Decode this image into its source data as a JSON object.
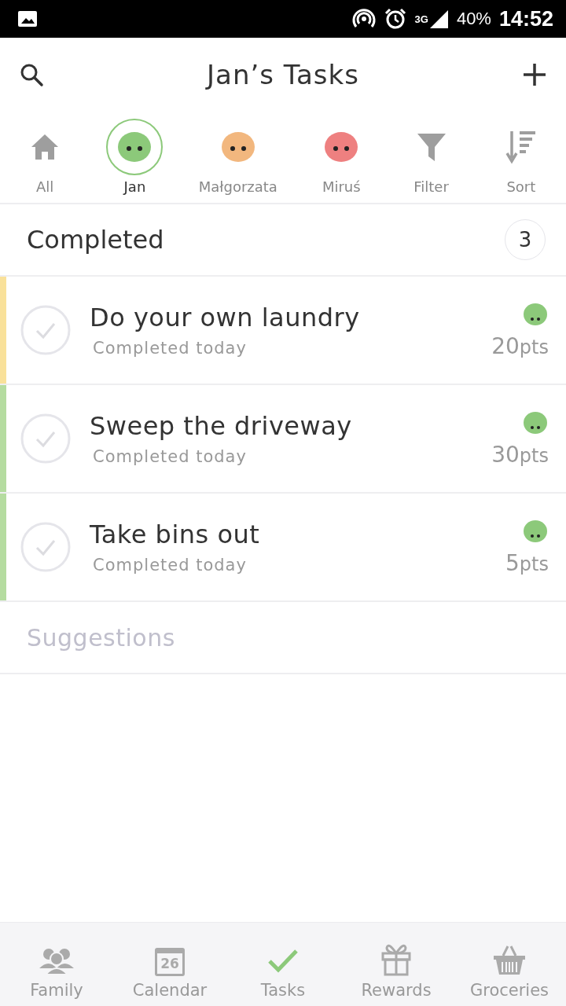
{
  "status_bar": {
    "battery": "40%",
    "network": "3G",
    "time": "14:52"
  },
  "header": {
    "title": "Jan’s Tasks"
  },
  "people": [
    {
      "label": "All",
      "kind": "home",
      "selected": false
    },
    {
      "label": "Jan",
      "kind": "avatar",
      "color": "#8cc97a",
      "selected": true
    },
    {
      "label": "Małgorzata",
      "kind": "avatar",
      "color": "#f2b77e",
      "selected": false
    },
    {
      "label": "Miruś",
      "kind": "avatar",
      "color": "#ee8080",
      "selected": false
    },
    {
      "label": "Filter",
      "kind": "filter",
      "selected": false
    },
    {
      "label": "Sort",
      "kind": "sort",
      "selected": false
    }
  ],
  "completed": {
    "title": "Completed",
    "count": "3"
  },
  "tasks": [
    {
      "title": "Do your own laundry",
      "subtitle": "Completed today",
      "points": "20",
      "unit": "pts",
      "color": "#f9e19a",
      "checked": true
    },
    {
      "title": "Sweep the driveway",
      "subtitle": "Completed today",
      "points": "30",
      "unit": "pts",
      "color": "#b5dca0",
      "checked": true
    },
    {
      "title": "Take bins out",
      "subtitle": "Completed today",
      "points": "5",
      "unit": "pts",
      "color": "#b5dca0",
      "checked": true
    }
  ],
  "suggestions": {
    "title": "Suggestions"
  },
  "bottom_nav": [
    {
      "label": "Family",
      "kind": "family",
      "selected": false
    },
    {
      "label": "Calendar",
      "kind": "calendar",
      "day": "26",
      "selected": false
    },
    {
      "label": "Tasks",
      "kind": "tasks",
      "selected": true
    },
    {
      "label": "Rewards",
      "kind": "rewards",
      "selected": false
    },
    {
      "label": "Groceries",
      "kind": "groceries",
      "selected": false
    }
  ]
}
